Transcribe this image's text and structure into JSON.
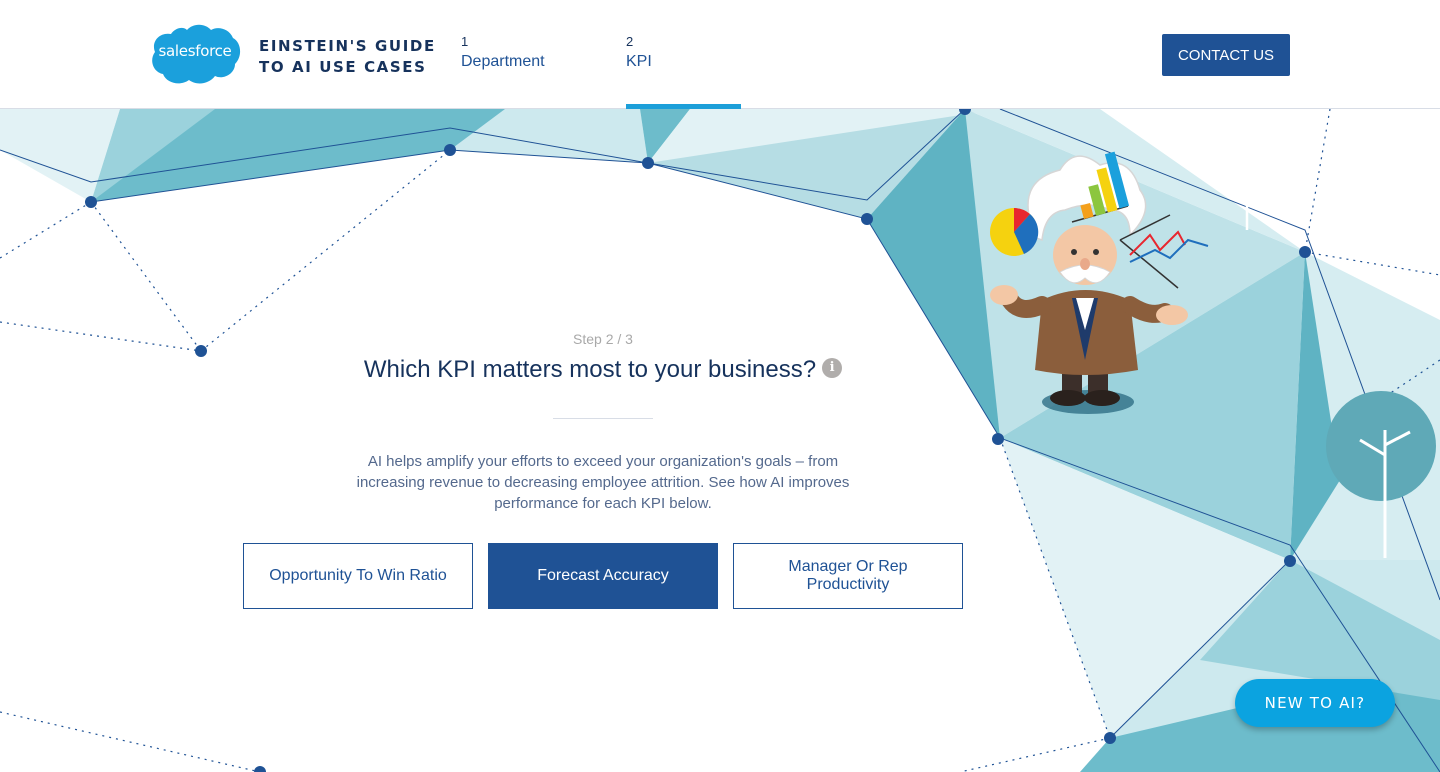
{
  "header": {
    "logo_text": "salesforce",
    "guide_title_line1": "EINSTEIN'S GUIDE",
    "guide_title_line2": "TO AI USE CASES",
    "steps": [
      {
        "number": "1",
        "label": "Department"
      },
      {
        "number": "2",
        "label": "KPI"
      }
    ],
    "contact_label": "CONTACT US"
  },
  "main": {
    "step_indicator": "Step 2 / 3",
    "question": "Which KPI matters most to your business?",
    "info_icon_glyph": "i",
    "description": "AI helps amplify your efforts to exceed your organization's goals – from increasing revenue to decreasing employee attrition. See how AI improves performance for each KPI below.",
    "kpi_options": [
      {
        "label": "Opportunity To Win Ratio",
        "selected": false
      },
      {
        "label": "Forecast Accuracy",
        "selected": true
      },
      {
        "label": "Manager Or Rep Productivity",
        "selected": false
      }
    ]
  },
  "floating": {
    "new_to_ai_label": "NEW TO AI?"
  },
  "colors": {
    "brand_blue": "#1f5295",
    "accent_blue": "#1c9fd9",
    "teal_light": "#cde9ee",
    "teal_mid": "#9bd2dc",
    "teal_dark": "#5fb3c3",
    "dot": "#1f5295"
  }
}
